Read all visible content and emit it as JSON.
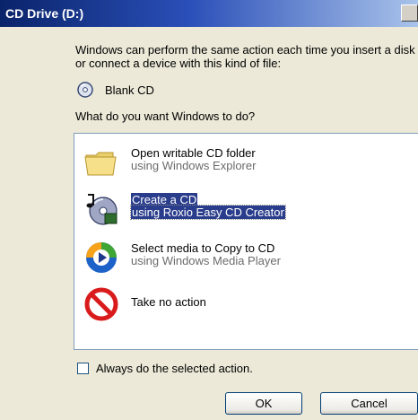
{
  "window": {
    "title": "CD Drive (D:)"
  },
  "intro_text": "Windows can perform the same action each time you insert a disk or connect a device with this kind of file:",
  "content_type": {
    "label": "Blank CD",
    "icon": "blank-cd-icon"
  },
  "question": "What do you want Windows to do?",
  "actions": [
    {
      "title": "Open writable CD folder",
      "subtitle": "using Windows Explorer",
      "icon": "folder-icon",
      "selected": false
    },
    {
      "title": "Create a CD",
      "subtitle": "using Roxio Easy CD Creator",
      "icon": "cd-creator-icon",
      "selected": true
    },
    {
      "title": "Select media to Copy to CD",
      "subtitle": "using Windows Media Player",
      "icon": "media-player-icon",
      "selected": false
    },
    {
      "title": "Take no action",
      "subtitle": "",
      "icon": "no-action-icon",
      "selected": false
    }
  ],
  "always_checkbox": {
    "label": "Always do the selected action.",
    "checked": false
  },
  "buttons": {
    "ok": "OK",
    "cancel": "Cancel"
  }
}
